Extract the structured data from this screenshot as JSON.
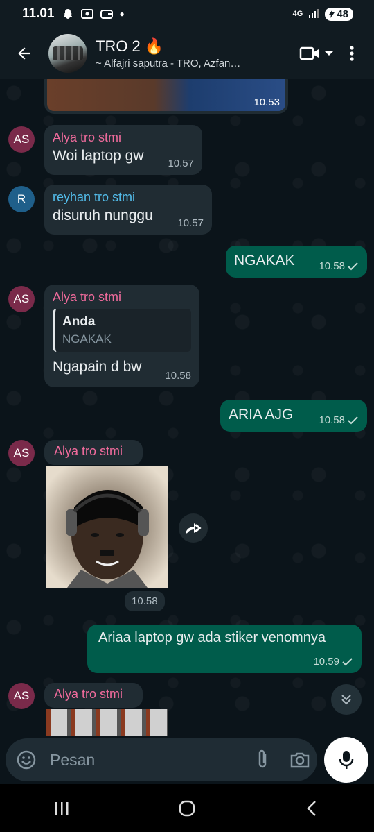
{
  "status": {
    "time": "11.01",
    "network": "4G",
    "battery": "48"
  },
  "header": {
    "title": "TRO 2",
    "title_emoji": "🔥",
    "subtitle": "~ Alfajri saputra - TRO, Azfan…"
  },
  "messages": [
    {
      "type": "image-partial",
      "time": "10.53"
    },
    {
      "sender": "Alya tro stmi",
      "initials": "AS",
      "text": "Woi laptop gw",
      "time": "10.57"
    },
    {
      "sender": "reyhan tro stmi",
      "initials": "R",
      "text": "disuruh nunggu",
      "time": "10.57"
    },
    {
      "direction": "out",
      "text": "NGAKAK",
      "time": "10.58"
    },
    {
      "sender": "Alya tro stmi",
      "initials": "AS",
      "quote_author": "Anda",
      "quote_text": "NGAKAK",
      "text": "Ngapain d bw",
      "time": "10.58"
    },
    {
      "direction": "out",
      "text": "ARIA AJG",
      "time": "10.58"
    },
    {
      "sender": "Alya tro stmi",
      "initials": "AS",
      "type": "sticker",
      "time": "10.58"
    },
    {
      "direction": "out",
      "text": "Ariaa laptop gw ada stiker venomnya",
      "time": "10.59"
    },
    {
      "sender": "Alya tro stmi",
      "initials": "AS",
      "type": "image-partial"
    }
  ],
  "input": {
    "placeholder": "Pesan"
  },
  "colors": {
    "header_bg": "#111b21",
    "chat_bg": "#0b141a",
    "incoming_bubble": "#202c33",
    "outgoing_bubble": "#005c4b",
    "alya_name": "#f06b9c",
    "reyhan_name": "#53bdeb",
    "alya_avatar": "#7a2a4a",
    "reyhan_avatar": "#1f5f8a"
  },
  "icons": [
    "back-arrow-icon",
    "video-call-icon",
    "dropdown-icon",
    "more-vert-icon",
    "forward-icon",
    "scroll-down-icon",
    "emoji-icon",
    "attach-icon",
    "camera-icon",
    "mic-icon",
    "recents-icon",
    "home-icon",
    "back-nav-icon"
  ]
}
